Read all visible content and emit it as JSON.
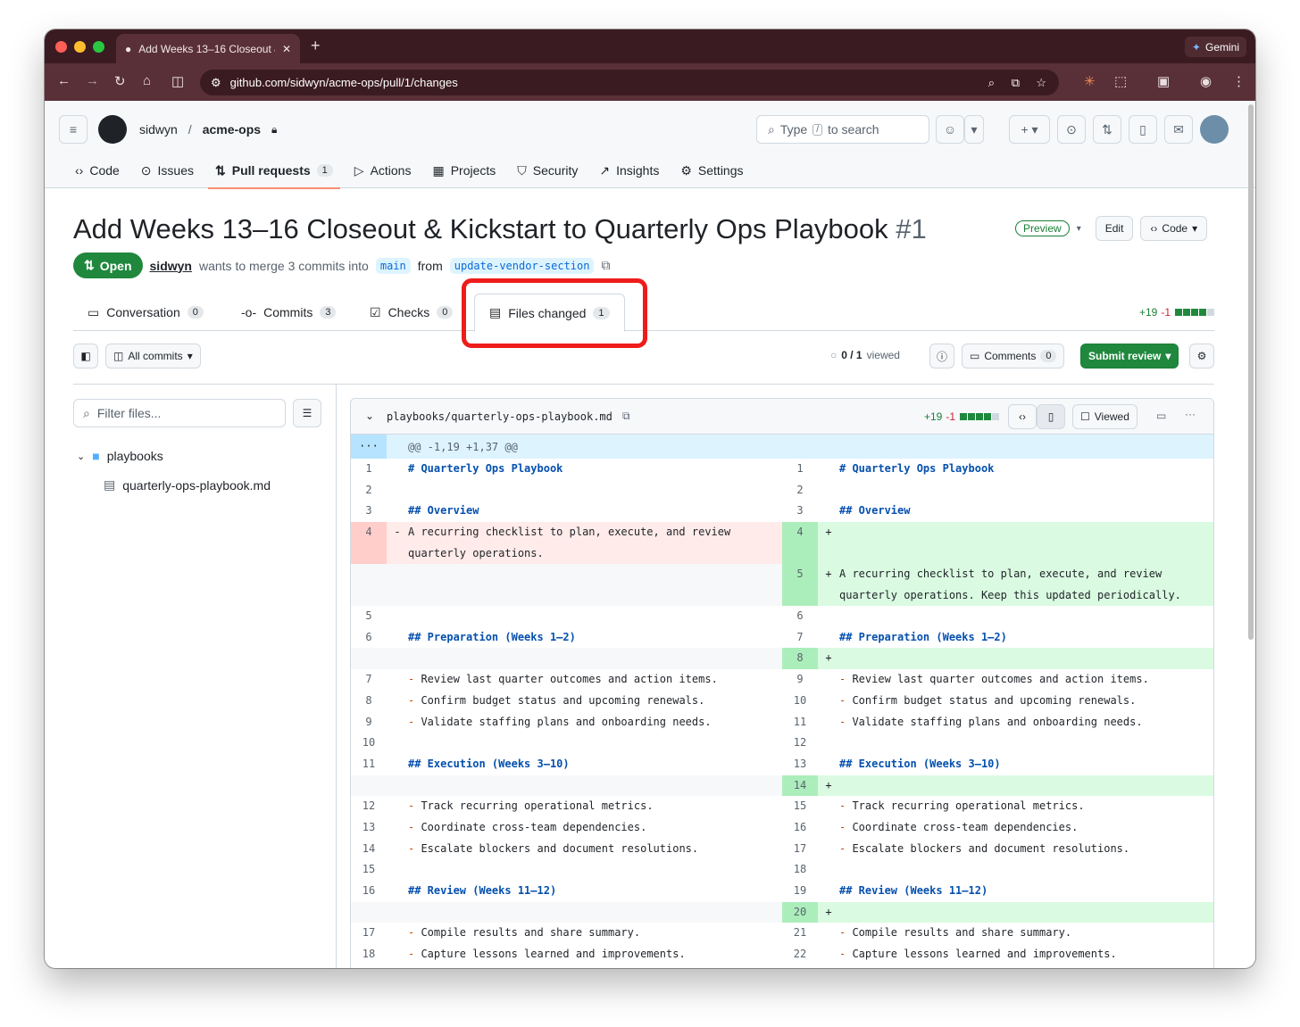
{
  "browser": {
    "tab_title": "Add Weeks 13–16 Closeout &",
    "url": "github.com/sidwyn/acme-ops/pull/1/changes",
    "gemini_label": "Gemini"
  },
  "header": {
    "owner": "sidwyn",
    "repo": "acme-ops",
    "search_prefix": "Type",
    "search_key": "/",
    "search_suffix": "to search",
    "nav": [
      {
        "label": "Code"
      },
      {
        "label": "Issues"
      },
      {
        "label": "Pull requests",
        "count": "1"
      },
      {
        "label": "Actions"
      },
      {
        "label": "Projects"
      },
      {
        "label": "Security"
      },
      {
        "label": "Insights"
      },
      {
        "label": "Settings"
      }
    ]
  },
  "pr": {
    "title": "Add Weeks 13–16 Closeout & Kickstart to Quarterly Ops Playbook",
    "number": "#1",
    "preview_label": "Preview",
    "edit_label": "Edit",
    "code_label": "Code",
    "state": "Open",
    "author": "sidwyn",
    "merge_text": "wants to merge 3 commits into",
    "base": "main",
    "from_text": "from",
    "head": "update-vendor-section"
  },
  "tabs": [
    {
      "label": "Conversation",
      "count": "0"
    },
    {
      "label": "Commits",
      "count": "3"
    },
    {
      "label": "Checks",
      "count": "0"
    },
    {
      "label": "Files changed",
      "count": "1"
    }
  ],
  "stats": {
    "additions": "+19",
    "deletions": "-1"
  },
  "toolbar": {
    "all_commits": "All commits",
    "viewed_progress": "0 / 1",
    "viewed_label": "viewed",
    "comments_label": "Comments",
    "comments_count": "0",
    "submit_label": "Submit review"
  },
  "sidebar": {
    "filter_placeholder": "Filter files...",
    "folder": "playbooks",
    "file": "quarterly-ops-playbook.md"
  },
  "file": {
    "path": "playbooks/quarterly-ops-playbook.md",
    "additions": "+19",
    "deletions": "-1",
    "viewed_label": "Viewed",
    "hunk": "@@ -1,19 +1,37 @@"
  },
  "diff": [
    {
      "l": "1",
      "ls": "",
      "lt": "# Quarterly Ops Playbook",
      "r": "1",
      "rs": "",
      "rt": "# Quarterly Ops Playbook",
      "type": "ctx",
      "h": true
    },
    {
      "l": "2",
      "ls": "",
      "lt": "",
      "r": "2",
      "rs": "",
      "rt": "",
      "type": "ctx"
    },
    {
      "l": "3",
      "ls": "",
      "lt": "## Overview",
      "r": "3",
      "rs": "",
      "rt": "## Overview",
      "type": "ctx",
      "h": true
    },
    {
      "l": "4",
      "ls": "-",
      "lt": "A recurring checklist to plan, execute, and review quarterly operations.",
      "r": "4",
      "rs": "+",
      "rt": "",
      "type": "chg",
      "tall": true
    },
    {
      "l": "",
      "ls": "",
      "lt": "",
      "r": "5",
      "rs": "+",
      "rt": "A recurring checklist to plan, execute, and review quarterly operations. Keep this updated periodically.",
      "type": "add",
      "tall": true
    },
    {
      "l": "5",
      "ls": "",
      "lt": "",
      "r": "6",
      "rs": "",
      "rt": "",
      "type": "ctx"
    },
    {
      "l": "6",
      "ls": "",
      "lt": "## Preparation (Weeks 1–2)",
      "r": "7",
      "rs": "",
      "rt": "## Preparation (Weeks 1–2)",
      "type": "ctx",
      "h": true
    },
    {
      "l": "",
      "ls": "",
      "lt": "",
      "r": "8",
      "rs": "+",
      "rt": "",
      "type": "add"
    },
    {
      "l": "7",
      "ls": "",
      "lt": "- Review last quarter outcomes and action items.",
      "r": "9",
      "rs": "",
      "rt": "- Review last quarter outcomes and action items.",
      "type": "ctx"
    },
    {
      "l": "8",
      "ls": "",
      "lt": "- Confirm budget status and upcoming renewals.",
      "r": "10",
      "rs": "",
      "rt": "- Confirm budget status and upcoming renewals.",
      "type": "ctx"
    },
    {
      "l": "9",
      "ls": "",
      "lt": "- Validate staffing plans and onboarding needs.",
      "r": "11",
      "rs": "",
      "rt": "- Validate staffing plans and onboarding needs.",
      "type": "ctx"
    },
    {
      "l": "10",
      "ls": "",
      "lt": "",
      "r": "12",
      "rs": "",
      "rt": "",
      "type": "ctx"
    },
    {
      "l": "11",
      "ls": "",
      "lt": "## Execution (Weeks 3–10)",
      "r": "13",
      "rs": "",
      "rt": "## Execution (Weeks 3–10)",
      "type": "ctx",
      "h": true
    },
    {
      "l": "",
      "ls": "",
      "lt": "",
      "r": "14",
      "rs": "+",
      "rt": "",
      "type": "add"
    },
    {
      "l": "12",
      "ls": "",
      "lt": "- Track recurring operational metrics.",
      "r": "15",
      "rs": "",
      "rt": "- Track recurring operational metrics.",
      "type": "ctx"
    },
    {
      "l": "13",
      "ls": "",
      "lt": "- Coordinate cross-team dependencies.",
      "r": "16",
      "rs": "",
      "rt": "- Coordinate cross-team dependencies.",
      "type": "ctx"
    },
    {
      "l": "14",
      "ls": "",
      "lt": "- Escalate blockers and document resolutions.",
      "r": "17",
      "rs": "",
      "rt": "- Escalate blockers and document resolutions.",
      "type": "ctx"
    },
    {
      "l": "15",
      "ls": "",
      "lt": "",
      "r": "18",
      "rs": "",
      "rt": "",
      "type": "ctx"
    },
    {
      "l": "16",
      "ls": "",
      "lt": "## Review (Weeks 11–12)",
      "r": "19",
      "rs": "",
      "rt": "## Review (Weeks 11–12)",
      "type": "ctx",
      "h": true
    },
    {
      "l": "",
      "ls": "",
      "lt": "",
      "r": "20",
      "rs": "+",
      "rt": "",
      "type": "add"
    },
    {
      "l": "17",
      "ls": "",
      "lt": "- Compile results and share summary.",
      "r": "21",
      "rs": "",
      "rt": "- Compile results and share summary.",
      "type": "ctx"
    },
    {
      "l": "18",
      "ls": "",
      "lt": "- Capture lessons learned and improvements.",
      "r": "22",
      "rs": "",
      "rt": "- Capture lessons learned and improvements.",
      "type": "ctx"
    }
  ]
}
